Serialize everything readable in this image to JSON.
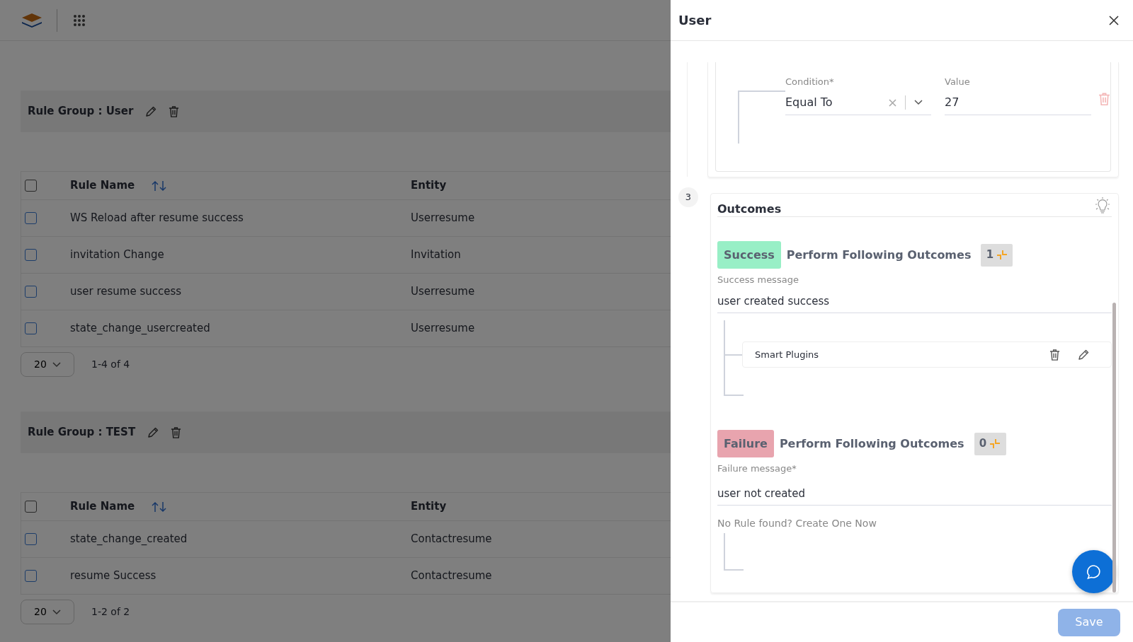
{
  "rule_groups": [
    {
      "title": "Rule Group : User",
      "table": {
        "select_all_checked": false,
        "columns": [
          "Rule Name",
          "Entity"
        ],
        "rows": [
          {
            "rule_name": "WS Reload after resume success",
            "entity": "Userresume",
            "checked": false
          },
          {
            "rule_name": "invitation Change",
            "entity": "Invitation",
            "checked": false
          },
          {
            "rule_name": "user resume success",
            "entity": "Userresume",
            "checked": false
          },
          {
            "rule_name": "state_change_usercreated",
            "entity": "Userresume",
            "checked": false
          }
        ]
      },
      "pagination": {
        "page_size": "20",
        "range": "1-4 of 4"
      }
    },
    {
      "title": "Rule Group : TEST",
      "table": {
        "select_all_checked": false,
        "columns": [
          "Rule Name",
          "Entity"
        ],
        "rows": [
          {
            "rule_name": "state_change_created",
            "entity": "Contactresume",
            "checked": false
          },
          {
            "rule_name": "resume Success",
            "entity": "Contactresume",
            "checked": false
          }
        ]
      },
      "pagination": {
        "page_size": "20",
        "range": "1-2 of 2"
      }
    }
  ],
  "drawer": {
    "title": "User",
    "condition": {
      "label": "Condition*",
      "value": "Equal To"
    },
    "value_field": {
      "label": "Value",
      "value": "27"
    },
    "step": "3",
    "outcomes_title": "Outcomes",
    "outcomes": [
      {
        "kind": "success",
        "badge": "Success",
        "heading": "Perform Following Outcomes",
        "count": "1",
        "message_label": "Success message",
        "message": "user created success",
        "plugins": [
          {
            "name": "Smart Plugins"
          }
        ]
      },
      {
        "kind": "failure",
        "badge": "Failure",
        "heading": "Perform Following Outcomes",
        "count": "0",
        "message_label": "Failure message*",
        "message": "user not created",
        "empty_text": "No Rule found? Create One Now"
      }
    ],
    "save_button": {
      "label": "Save",
      "disabled": true
    }
  }
}
